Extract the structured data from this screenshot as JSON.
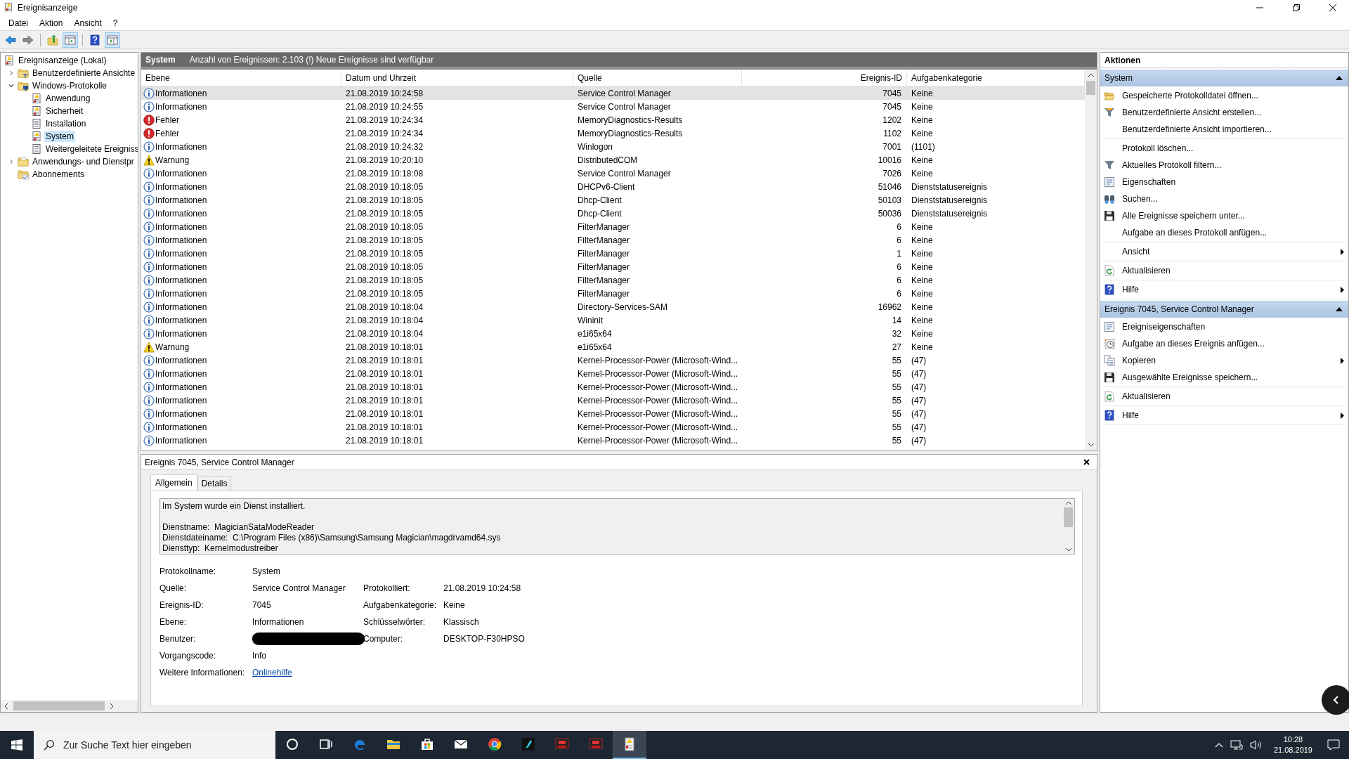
{
  "window": {
    "title": "Ereignisanzeige"
  },
  "menu": [
    "Datei",
    "Aktion",
    "Ansicht",
    "?"
  ],
  "toolbar": [
    {
      "pressed": false
    },
    {
      "pressed": false
    },
    {
      "pressed": false
    },
    {
      "pressed": true
    },
    {
      "pressed": false
    },
    {
      "pressed": true
    }
  ],
  "tree": [
    {
      "label": "Ereignisanzeige (Lokal)",
      "kind": "viewer",
      "selected": false,
      "children": [
        {
          "label": "Benutzerdefinierte Ansichte",
          "kind": "views-folder",
          "expanded": false,
          "selected": false
        },
        {
          "label": "Windows-Protokolle",
          "kind": "logs-folder",
          "expanded": true,
          "selected": false,
          "children": [
            {
              "label": "Anwendung",
              "kind": "log",
              "selected": false
            },
            {
              "label": "Sicherheit",
              "kind": "log",
              "selected": false
            },
            {
              "label": "Installation",
              "kind": "plain-log",
              "selected": false
            },
            {
              "label": "System",
              "kind": "log",
              "selected": true
            },
            {
              "label": "Weitergeleitete Ereigniss",
              "kind": "plain-log",
              "selected": false
            }
          ]
        },
        {
          "label": "Anwendungs- und Dienstpr",
          "kind": "folder",
          "expanded": false,
          "selected": false
        },
        {
          "label": "Abonnements",
          "kind": "subscriptions",
          "selected": false
        }
      ]
    }
  ],
  "log_header": {
    "title": "System",
    "summary": "Anzahl von Ereignissen: 2.103 (!) Neue Ereignisse sind verfügbar"
  },
  "table": {
    "columns": [
      "Ebene",
      "Datum und Uhrzeit",
      "Quelle",
      "Ereignis-ID",
      "Aufgabenkategorie"
    ],
    "rows": [
      {
        "kind": "info",
        "selected": true,
        "cells": [
          "Informationen",
          "21.08.2019 10:24:58",
          "Service Control Manager",
          "7045",
          "Keine"
        ]
      },
      {
        "kind": "info",
        "selected": false,
        "cells": [
          "Informationen",
          "21.08.2019 10:24:55",
          "Service Control Manager",
          "7045",
          "Keine"
        ]
      },
      {
        "kind": "error",
        "selected": false,
        "cells": [
          "Fehler",
          "21.08.2019 10:24:34",
          "MemoryDiagnostics-Results",
          "1202",
          "Keine"
        ]
      },
      {
        "kind": "error",
        "selected": false,
        "cells": [
          "Fehler",
          "21.08.2019 10:24:34",
          "MemoryDiagnostics-Results",
          "1102",
          "Keine"
        ]
      },
      {
        "kind": "info",
        "selected": false,
        "cells": [
          "Informationen",
          "21.08.2019 10:24:32",
          "Winlogon",
          "7001",
          "(1101)"
        ]
      },
      {
        "kind": "warning",
        "selected": false,
        "cells": [
          "Warnung",
          "21.08.2019 10:20:10",
          "DistributedCOM",
          "10016",
          "Keine"
        ]
      },
      {
        "kind": "info",
        "selected": false,
        "cells": [
          "Informationen",
          "21.08.2019 10:18:08",
          "Service Control Manager",
          "7026",
          "Keine"
        ]
      },
      {
        "kind": "info",
        "selected": false,
        "cells": [
          "Informationen",
          "21.08.2019 10:18:05",
          "DHCPv6-Client",
          "51046",
          "Dienststatusereignis"
        ]
      },
      {
        "kind": "info",
        "selected": false,
        "cells": [
          "Informationen",
          "21.08.2019 10:18:05",
          "Dhcp-Client",
          "50103",
          "Dienststatusereignis"
        ]
      },
      {
        "kind": "info",
        "selected": false,
        "cells": [
          "Informationen",
          "21.08.2019 10:18:05",
          "Dhcp-Client",
          "50036",
          "Dienststatusereignis"
        ]
      },
      {
        "kind": "info",
        "selected": false,
        "cells": [
          "Informationen",
          "21.08.2019 10:18:05",
          "FilterManager",
          "6",
          "Keine"
        ]
      },
      {
        "kind": "info",
        "selected": false,
        "cells": [
          "Informationen",
          "21.08.2019 10:18:05",
          "FilterManager",
          "6",
          "Keine"
        ]
      },
      {
        "kind": "info",
        "selected": false,
        "cells": [
          "Informationen",
          "21.08.2019 10:18:05",
          "FilterManager",
          "1",
          "Keine"
        ]
      },
      {
        "kind": "info",
        "selected": false,
        "cells": [
          "Informationen",
          "21.08.2019 10:18:05",
          "FilterManager",
          "6",
          "Keine"
        ]
      },
      {
        "kind": "info",
        "selected": false,
        "cells": [
          "Informationen",
          "21.08.2019 10:18:05",
          "FilterManager",
          "6",
          "Keine"
        ]
      },
      {
        "kind": "info",
        "selected": false,
        "cells": [
          "Informationen",
          "21.08.2019 10:18:05",
          "FilterManager",
          "6",
          "Keine"
        ]
      },
      {
        "kind": "info",
        "selected": false,
        "cells": [
          "Informationen",
          "21.08.2019 10:18:04",
          "Directory-Services-SAM",
          "16962",
          "Keine"
        ]
      },
      {
        "kind": "info",
        "selected": false,
        "cells": [
          "Informationen",
          "21.08.2019 10:18:04",
          "Wininit",
          "14",
          "Keine"
        ]
      },
      {
        "kind": "info",
        "selected": false,
        "cells": [
          "Informationen",
          "21.08.2019 10:18:04",
          "e1i65x64",
          "32",
          "Keine"
        ]
      },
      {
        "kind": "warning",
        "selected": false,
        "cells": [
          "Warnung",
          "21.08.2019 10:18:01",
          "e1i65x64",
          "27",
          "Keine"
        ]
      },
      {
        "kind": "info",
        "selected": false,
        "cells": [
          "Informationen",
          "21.08.2019 10:18:01",
          "Kernel-Processor-Power (Microsoft-Wind...",
          "55",
          "(47)"
        ]
      },
      {
        "kind": "info",
        "selected": false,
        "cells": [
          "Informationen",
          "21.08.2019 10:18:01",
          "Kernel-Processor-Power (Microsoft-Wind...",
          "55",
          "(47)"
        ]
      },
      {
        "kind": "info",
        "selected": false,
        "cells": [
          "Informationen",
          "21.08.2019 10:18:01",
          "Kernel-Processor-Power (Microsoft-Wind...",
          "55",
          "(47)"
        ]
      },
      {
        "kind": "info",
        "selected": false,
        "cells": [
          "Informationen",
          "21.08.2019 10:18:01",
          "Kernel-Processor-Power (Microsoft-Wind...",
          "55",
          "(47)"
        ]
      },
      {
        "kind": "info",
        "selected": false,
        "cells": [
          "Informationen",
          "21.08.2019 10:18:01",
          "Kernel-Processor-Power (Microsoft-Wind...",
          "55",
          "(47)"
        ]
      },
      {
        "kind": "info",
        "selected": false,
        "cells": [
          "Informationen",
          "21.08.2019 10:18:01",
          "Kernel-Processor-Power (Microsoft-Wind...",
          "55",
          "(47)"
        ]
      },
      {
        "kind": "info",
        "selected": false,
        "cells": [
          "Informationen",
          "21.08.2019 10:18:01",
          "Kernel-Processor-Power (Microsoft-Wind...",
          "55",
          "(47)"
        ]
      }
    ]
  },
  "detail": {
    "title": "Ereignis 7045, Service Control Manager",
    "tabs": [
      {
        "label": "Allgemein",
        "selected": true
      },
      {
        "label": "Details",
        "selected": false
      }
    ],
    "message": [
      [
        "Im System wurde ein Dienst installiert."
      ],
      [
        "Dienstname:  MagicianSataModeReader",
        "Dienstdateiname:  C:\\Program Files (x86)\\Samsung\\Samsung Magician\\magdrvamd64.sys",
        "Diensttyp:  Kernelmodustreiber"
      ]
    ],
    "fields": [
      [
        {
          "kind": "text",
          "label": "Protokollname:",
          "value": "System"
        }
      ],
      [
        {
          "kind": "text",
          "label": "Quelle:",
          "value": "Service Control Manager"
        },
        {
          "kind": "text",
          "label": "Protokolliert:",
          "value": "21.08.2019 10:24:58"
        }
      ],
      [
        {
          "kind": "text",
          "label": "Ereignis-ID:",
          "value": "7045"
        },
        {
          "kind": "text",
          "label": "Aufgabenkategorie:",
          "value": "Keine"
        }
      ],
      [
        {
          "kind": "text",
          "label": "Ebene:",
          "value": "Informationen"
        },
        {
          "kind": "text",
          "label": "Schlüsselwörter:",
          "value": "Klassisch"
        }
      ],
      [
        {
          "kind": "redacted",
          "label": "Benutzer:"
        },
        {
          "kind": "text",
          "label": "Computer:",
          "value": "DESKTOP-F30HPSO"
        }
      ],
      [
        {
          "kind": "text",
          "label": "Vorgangscode:",
          "value": "Info"
        }
      ],
      [
        {
          "kind": "link",
          "label": "Weitere Informationen:",
          "value": "Onlinehilfe"
        }
      ]
    ]
  },
  "actions": {
    "title": "Aktionen",
    "sections": [
      {
        "title": "System",
        "expanded": true,
        "groups": [
          [
            {
              "kind": "open",
              "label": "Gespeicherte Protokolldatei öffnen...",
              "submenu": false
            },
            {
              "kind": "create-view",
              "label": "Benutzerdefinierte Ansicht erstellen...",
              "submenu": false
            },
            {
              "kind": "import-view",
              "label": "Benutzerdefinierte Ansicht importieren...",
              "submenu": false
            }
          ],
          [
            {
              "kind": "clear",
              "label": "Protokoll löschen...",
              "submenu": false
            },
            {
              "kind": "filter",
              "label": "Aktuelles Protokoll filtern...",
              "submenu": false
            },
            {
              "kind": "properties",
              "label": "Eigenschaften",
              "submenu": false
            },
            {
              "kind": "find",
              "label": "Suchen...",
              "submenu": false
            },
            {
              "kind": "save",
              "label": "Alle Ereignisse speichern unter...",
              "submenu": false
            },
            {
              "kind": "log-task",
              "label": "Aufgabe an dieses Protokoll anfügen...",
              "submenu": false
            }
          ],
          [
            {
              "kind": "view",
              "label": "Ansicht",
              "submenu": true
            }
          ],
          [
            {
              "kind": "refresh",
              "label": "Aktualisieren",
              "submenu": false
            }
          ],
          [
            {
              "kind": "help",
              "label": "Hilfe",
              "submenu": true
            }
          ]
        ]
      },
      {
        "title": "Ereignis 7045, Service Control Manager",
        "expanded": true,
        "groups": [
          [
            {
              "kind": "properties",
              "label": "Ereigniseigenschaften",
              "submenu": false
            },
            {
              "kind": "event-task",
              "label": "Aufgabe an dieses Ereignis anfügen...",
              "submenu": false
            },
            {
              "kind": "copy",
              "label": "Kopieren",
              "submenu": true
            },
            {
              "kind": "save",
              "label": "Ausgewählte Ereignisse speichern...",
              "submenu": false
            }
          ],
          [
            {
              "kind": "refresh",
              "label": "Aktualisieren",
              "submenu": false
            }
          ],
          [
            {
              "kind": "help",
              "label": "Hilfe",
              "submenu": true
            }
          ]
        ]
      }
    ]
  },
  "taskbar": {
    "search": {
      "placeholder": "Zur Suche Text hier eingeben"
    },
    "apps": [
      {
        "selected": false
      },
      {
        "selected": false
      },
      {
        "selected": false
      },
      {
        "selected": false
      },
      {
        "selected": false
      },
      {
        "selected": false
      },
      {
        "selected": false
      },
      {
        "selected": false
      },
      {
        "selected": false
      },
      {
        "selected": false
      },
      {
        "selected": true
      }
    ],
    "time": "10:28",
    "date": "21.08.2019"
  }
}
